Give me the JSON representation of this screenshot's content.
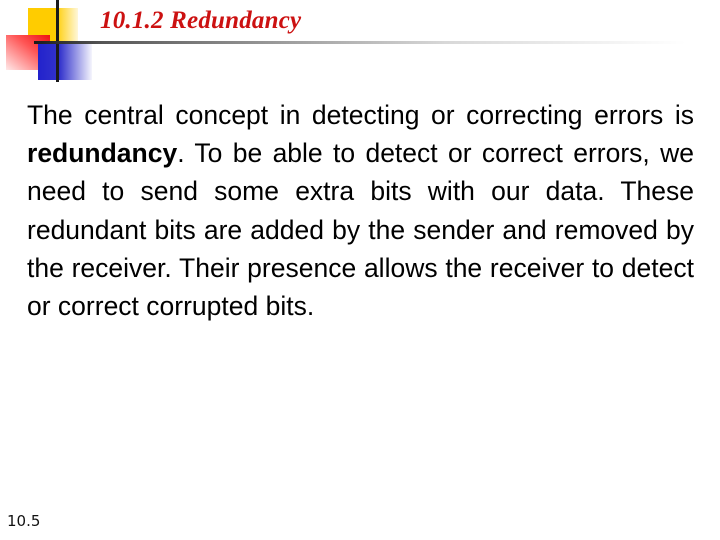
{
  "slide": {
    "title": "10.1.2 Redundancy",
    "title_color": "#cc1111",
    "body": {
      "part1": "The central concept in detecting or correcting errors is ",
      "bold_term": "redundancy",
      "part2": ". To be able to detect or correct errors, we need to send some extra bits with our data. These redundant bits are added by the sender and removed by the receiver. Their presence allows the receiver to detect or correct corrupted bits."
    },
    "slide_number": "10.5"
  },
  "logo": {
    "icon": "decorative-color-blocks-icon",
    "colors": {
      "yellow": "#ffcc00",
      "red": "#ee1111",
      "blue": "#2222cc",
      "line": "#1a1a1a"
    }
  }
}
